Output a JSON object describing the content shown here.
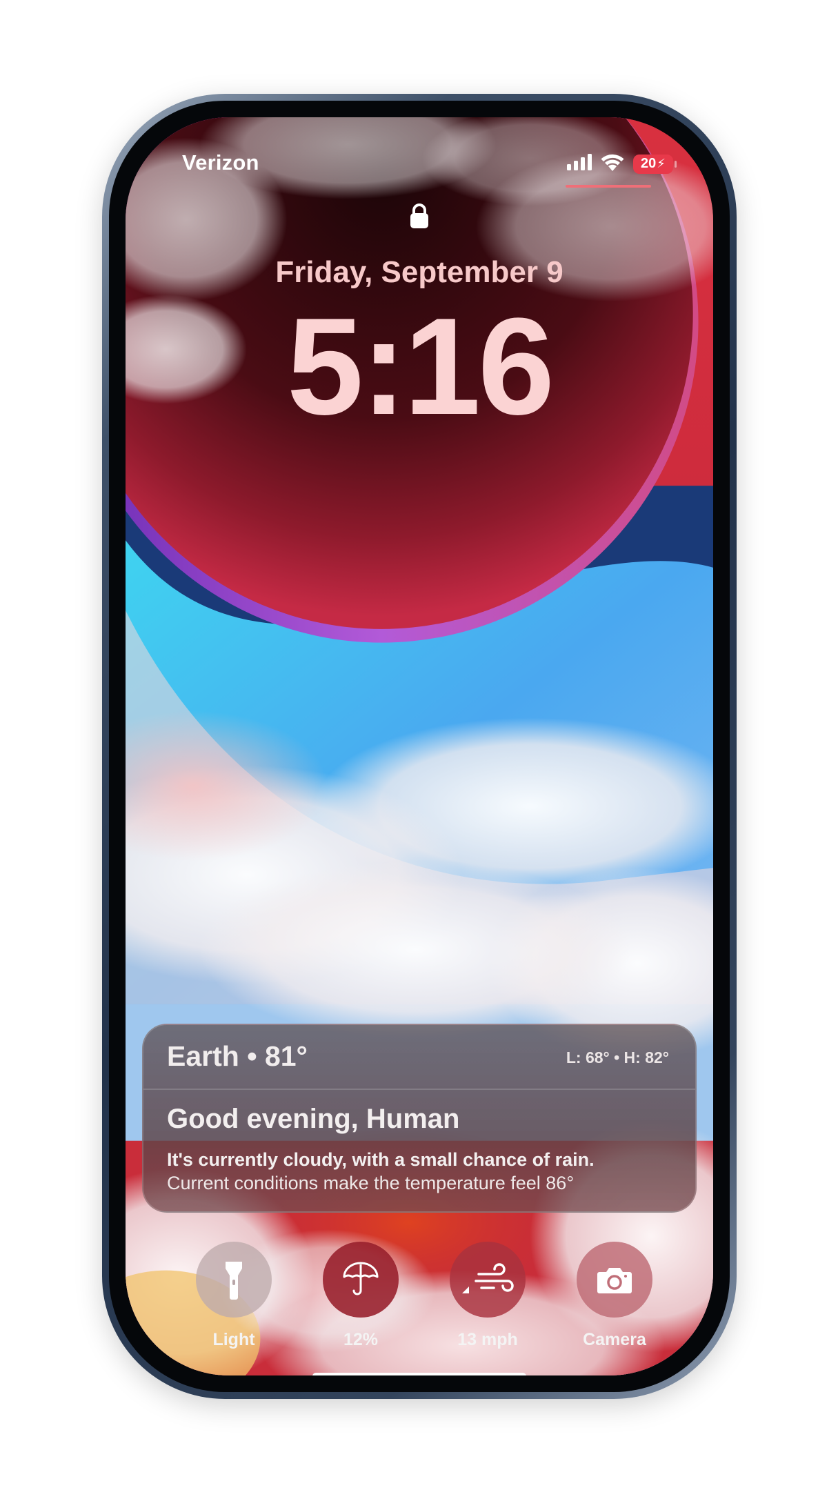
{
  "status_bar": {
    "carrier": "Verizon",
    "battery": "20"
  },
  "lock_screen": {
    "date": "Friday, September 9",
    "time": "5:16"
  },
  "weather_widget": {
    "location": "Earth • 81°",
    "high_low": "L: 68° • H: 82°",
    "greeting": "Good evening, Human",
    "summary": "It's currently cloudy, with a small chance of rain.",
    "feels_like": "Current conditions make the temperature feel 86°"
  },
  "controls": [
    {
      "label": "Light",
      "icon": "flashlight-icon"
    },
    {
      "label": "12%",
      "icon": "umbrella-icon"
    },
    {
      "label": "13 mph",
      "icon": "wind-icon"
    },
    {
      "label": "Camera",
      "icon": "camera-icon"
    }
  ],
  "colors": {
    "battery_low": "#e8394a",
    "wallpaper_red": "#c9283a",
    "wallpaper_blue": "#4aa8f0"
  }
}
